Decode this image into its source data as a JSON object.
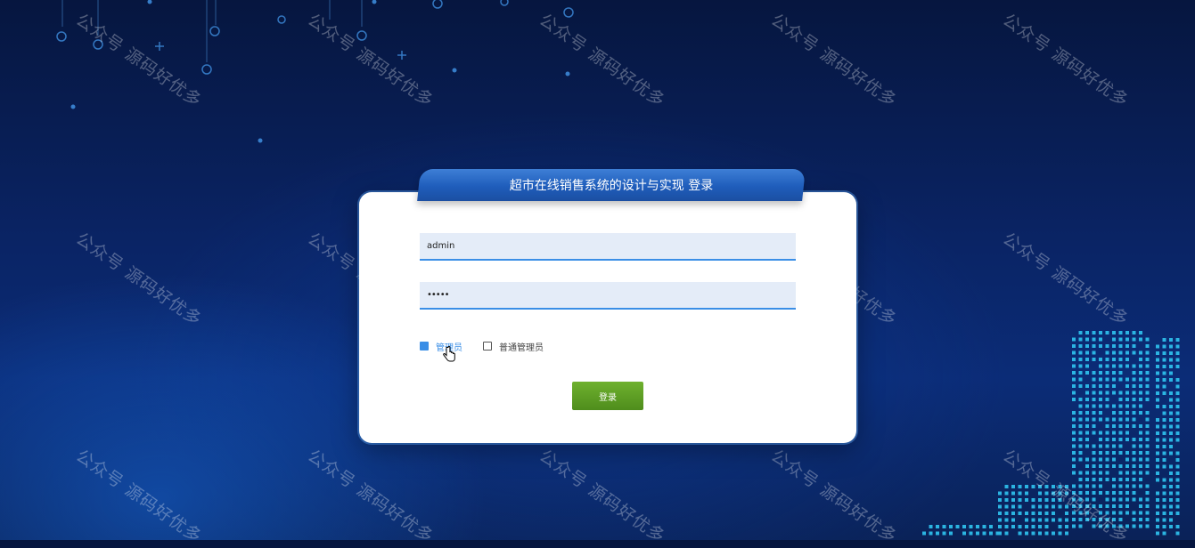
{
  "login": {
    "title": "超市在线销售系统的设计与实现 登录",
    "username_value": "admin",
    "password_value": "•••••",
    "roles": [
      {
        "label": "管理员",
        "selected": true
      },
      {
        "label": "普通管理员",
        "selected": false
      }
    ],
    "submit_label": "登录"
  },
  "watermark_text": "公众号 源码好优多",
  "colors": {
    "accent": "#3a8ee6",
    "button": "#5a9a22",
    "title_bar": "#1f5dbb",
    "background": "#0a2465"
  }
}
